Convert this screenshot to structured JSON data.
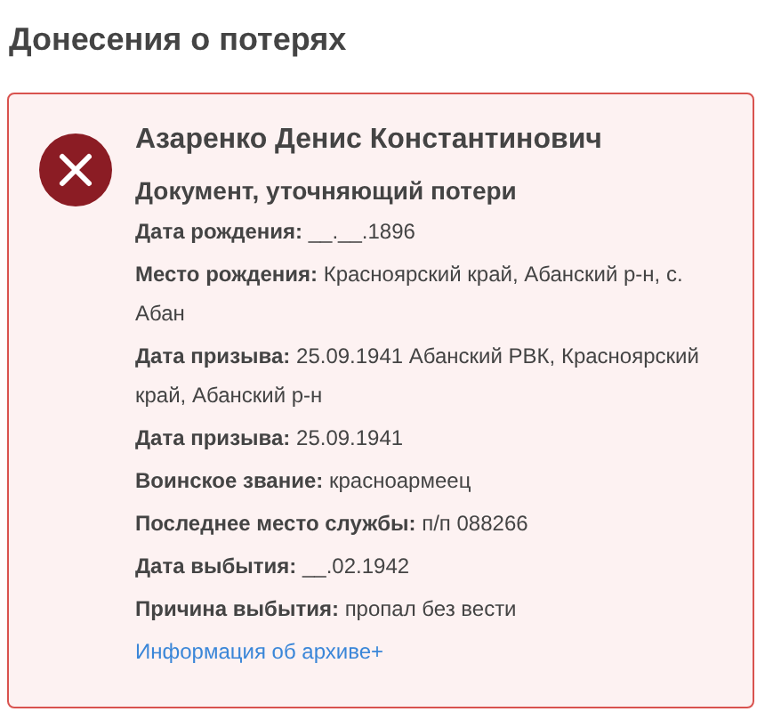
{
  "heading": "Донесения о потерях",
  "record": {
    "name": "Азаренко Денис Константинович",
    "document": "Документ, уточняющий потери",
    "fields": [
      {
        "label": "Дата рождения:",
        "value": "__.__.1896"
      },
      {
        "label": "Место рождения:",
        "value": "Красноярский край, Абанский р-н, с. Абан"
      },
      {
        "label": "Дата призыва:",
        "value": "25.09.1941 Абанский РВК, Красноярский край, Абанский р-н"
      },
      {
        "label": "Дата призыва:",
        "value": "25.09.1941"
      },
      {
        "label": "Воинское звание:",
        "value": "красноармеец"
      },
      {
        "label": "Последнее место службы:",
        "value": "п/п 088266"
      },
      {
        "label": "Дата выбытия:",
        "value": "__.02.1942"
      },
      {
        "label": "Причина выбытия:",
        "value": "пропал без вести"
      }
    ],
    "link": "Информация об архиве+"
  }
}
